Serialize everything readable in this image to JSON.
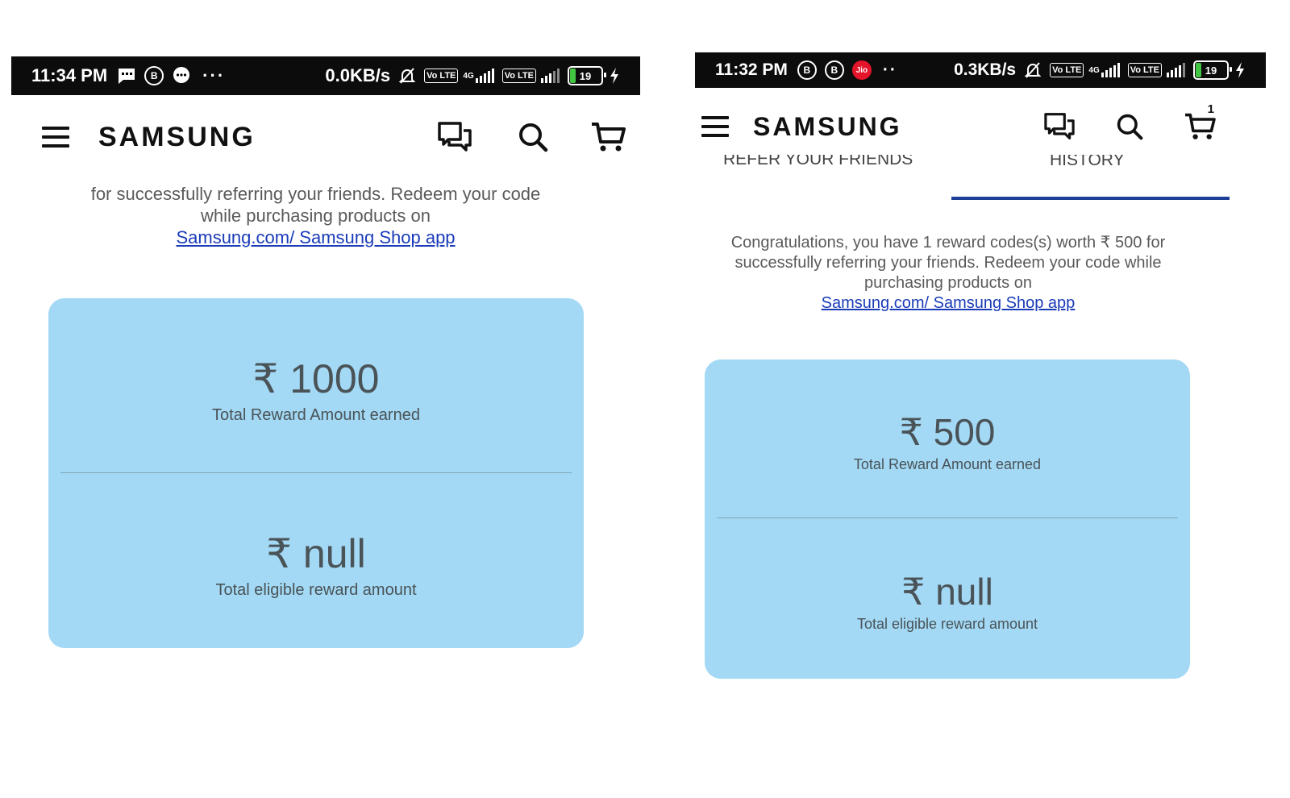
{
  "left_screen": {
    "status_bar": {
      "time": "11:34 PM",
      "overflow": "···",
      "net_speed": "0.0KB/s",
      "sim1_label": "Vo LTE",
      "network_type": "4G",
      "sim2_label": "Vo LTE",
      "battery": "19"
    },
    "header": {
      "logo": "SAMSUNG"
    },
    "intro": {
      "line1": "for successfully referring your friends. Redeem your code",
      "line2": "while purchasing products on",
      "link": "Samsung.com/ Samsung Shop app"
    },
    "card": {
      "earned_amount": "₹ 1000",
      "earned_label": "Total Reward Amount earned",
      "eligible_amount": "₹ null",
      "eligible_label": "Total eligible reward amount"
    }
  },
  "right_screen": {
    "status_bar": {
      "time": "11:32 PM",
      "jio_label": "Jio",
      "overflow": "··",
      "net_speed": "0.3KB/s",
      "sim1_label": "Vo LTE",
      "network_type": "4G",
      "sim2_label": "Vo LTE",
      "battery": "19"
    },
    "header": {
      "logo": "SAMSUNG",
      "cart_count": "1"
    },
    "tabs": {
      "refer_label": "REFER YOUR FRIENDS",
      "history_label": "HISTORY"
    },
    "intro": {
      "line1": "Congratulations, you have 1 reward codes(s) worth ₹ 500 for",
      "line2": "successfully referring your friends. Redeem your code while",
      "line3": "purchasing products on",
      "link": "Samsung.com/ Samsung Shop app"
    },
    "card": {
      "earned_amount": "₹ 500",
      "earned_label": "Total Reward Amount earned",
      "eligible_amount": "₹ null",
      "eligible_label": "Total eligible reward amount"
    }
  }
}
